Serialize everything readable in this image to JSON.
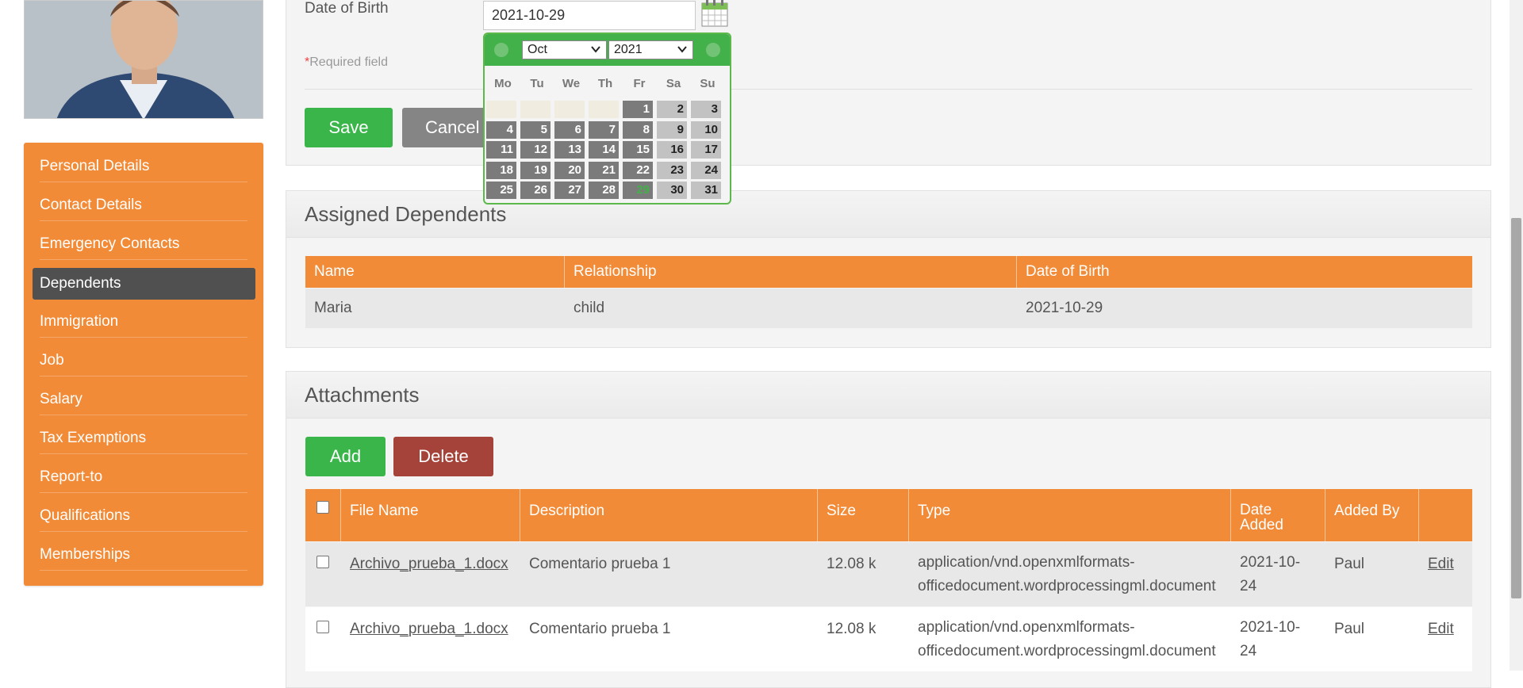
{
  "sidebar": {
    "items": [
      {
        "label": "Personal Details"
      },
      {
        "label": "Contact Details"
      },
      {
        "label": "Emergency Contacts"
      },
      {
        "label": "Dependents"
      },
      {
        "label": "Immigration"
      },
      {
        "label": "Job"
      },
      {
        "label": "Salary"
      },
      {
        "label": "Tax Exemptions"
      },
      {
        "label": "Report-to"
      },
      {
        "label": "Qualifications"
      },
      {
        "label": "Memberships"
      }
    ],
    "active": "Dependents",
    "color": "#f28b37"
  },
  "form": {
    "dob_label": "Date of Birth",
    "dob_value": "2021-10-29",
    "required_star": "*",
    "required_text": "Required field",
    "save_label": "Save",
    "cancel_label": "Cancel"
  },
  "datepicker": {
    "month": "Oct",
    "year": "2021",
    "days_of_week": [
      "Mo",
      "Tu",
      "We",
      "Th",
      "Fr",
      "Sa",
      "Su"
    ],
    "weeks": [
      [
        "",
        "",
        "",
        "",
        "1",
        "2",
        "3"
      ],
      [
        "4",
        "5",
        "6",
        "7",
        "8",
        "9",
        "10"
      ],
      [
        "11",
        "12",
        "13",
        "14",
        "15",
        "16",
        "17"
      ],
      [
        "18",
        "19",
        "20",
        "21",
        "22",
        "23",
        "24"
      ],
      [
        "25",
        "26",
        "27",
        "28",
        "29",
        "30",
        "31"
      ]
    ],
    "selected_day": "29"
  },
  "dependents": {
    "title": "Assigned Dependents",
    "columns": [
      "Name",
      "Relationship",
      "Date of Birth"
    ],
    "rows": [
      [
        "Maria",
        "child",
        "2021-10-29"
      ]
    ]
  },
  "attachments": {
    "title": "Attachments",
    "add_label": "Add",
    "delete_label": "Delete",
    "columns": [
      "File Name",
      "Description",
      "Size",
      "Type",
      "Date Added",
      "Added By"
    ],
    "column_date_added_lines": [
      "Date",
      "Added"
    ],
    "rows": [
      {
        "file": "Archivo_prueba_1.docx",
        "description": "Comentario prueba 1",
        "size": "12.08 k",
        "type_lines": [
          "application/vnd.openxmlformats-",
          "officedocument.wordprocessingml.document"
        ],
        "date_lines": [
          "2021-10-",
          "24"
        ],
        "added_by": "Paul",
        "action": "Edit"
      },
      {
        "file": "Archivo_prueba_1.docx",
        "description": "Comentario prueba 1",
        "size": "12.08 k",
        "type_lines": [
          "application/vnd.openxmlformats-",
          "officedocument.wordprocessingml.document"
        ],
        "date_lines": [
          "2021-10-",
          "24"
        ],
        "added_by": "Paul",
        "action": "Edit"
      }
    ]
  },
  "colors": {
    "green": "#3ab54a",
    "red": "#a5433a",
    "grey_button": "#858585",
    "active_nav": "#505050"
  }
}
